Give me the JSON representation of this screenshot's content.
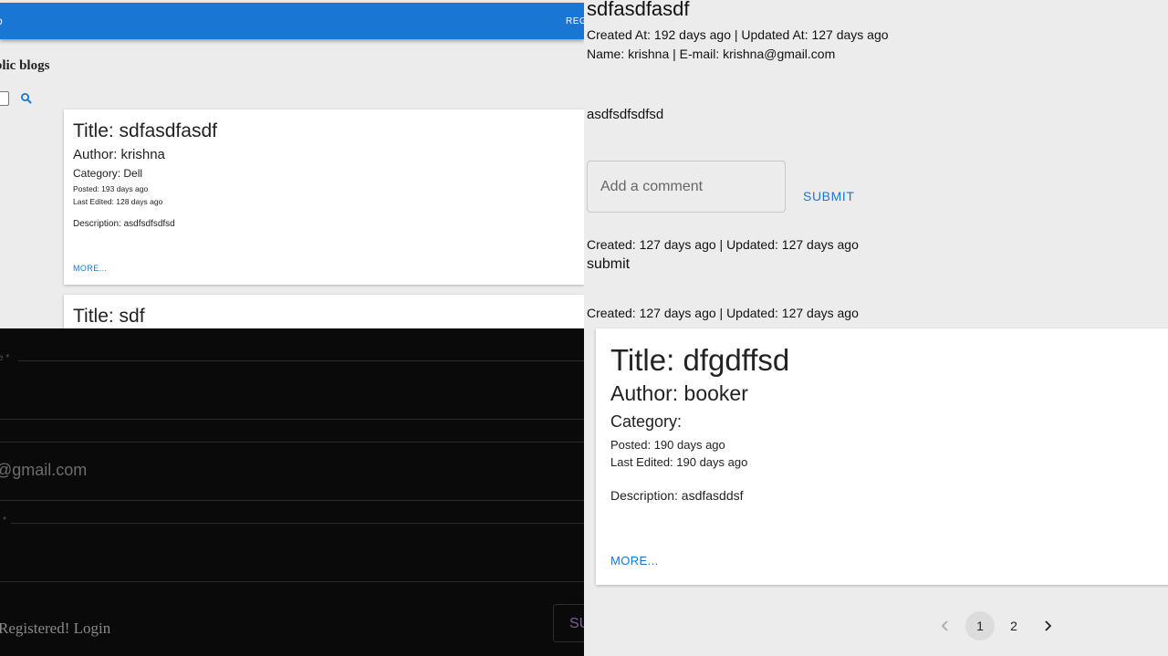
{
  "blog_list": {
    "nav_left": "o",
    "nav_right": "REG",
    "heading": "blic blogs",
    "cards": [
      {
        "title": "Title: sdfasdfasdf",
        "author": "Author: krishna",
        "category": "Category: Dell",
        "posted": "Posted: 193 days ago",
        "last_edited": "Last Edited: 128 days ago",
        "description": "Description: asdfsdfsdfsd",
        "more": "MORE..."
      },
      {
        "title": "Title: sdf"
      }
    ]
  },
  "blog_detail": {
    "title": "sdfasdfasdf",
    "created_updated": "Created At: 192 days ago | Updated At: 127 days ago",
    "name_email": "Name: krishna | E-mail: krishna@gmail.com",
    "body": "asdfsdfsdfsd",
    "comment_placeholder": "Add a comment",
    "submit_label": "SUBMIT",
    "comments": [
      {
        "meta": "Created: 127 days ago | Updated: 127 days ago",
        "text": "submit"
      },
      {
        "meta": "Created: 127 days ago | Updated: 127 days ago"
      }
    ]
  },
  "register_form": {
    "field1_label": "e *",
    "email_value": "@gmail.com",
    "field3_label": "l *",
    "login_link": "Registered! Login",
    "submit_partial": "SU"
  },
  "blog_list_2": {
    "card": {
      "title": "Title: dfgdffsd",
      "author": "Author: booker",
      "category": "Category:",
      "posted": "Posted: 190 days ago",
      "last_edited": "Last Edited: 190 days ago",
      "description": "Description: asdfasddsf",
      "more": "MORE..."
    },
    "pagination": {
      "pages": [
        "1",
        "2"
      ],
      "current": "1"
    }
  },
  "colors": {
    "primary": "#1976d2",
    "page_bg": "#ececec",
    "dark_bg": "#0a0a0a"
  },
  "icons": [
    "search-icon",
    "chevron-left-icon",
    "chevron-right-icon"
  ]
}
